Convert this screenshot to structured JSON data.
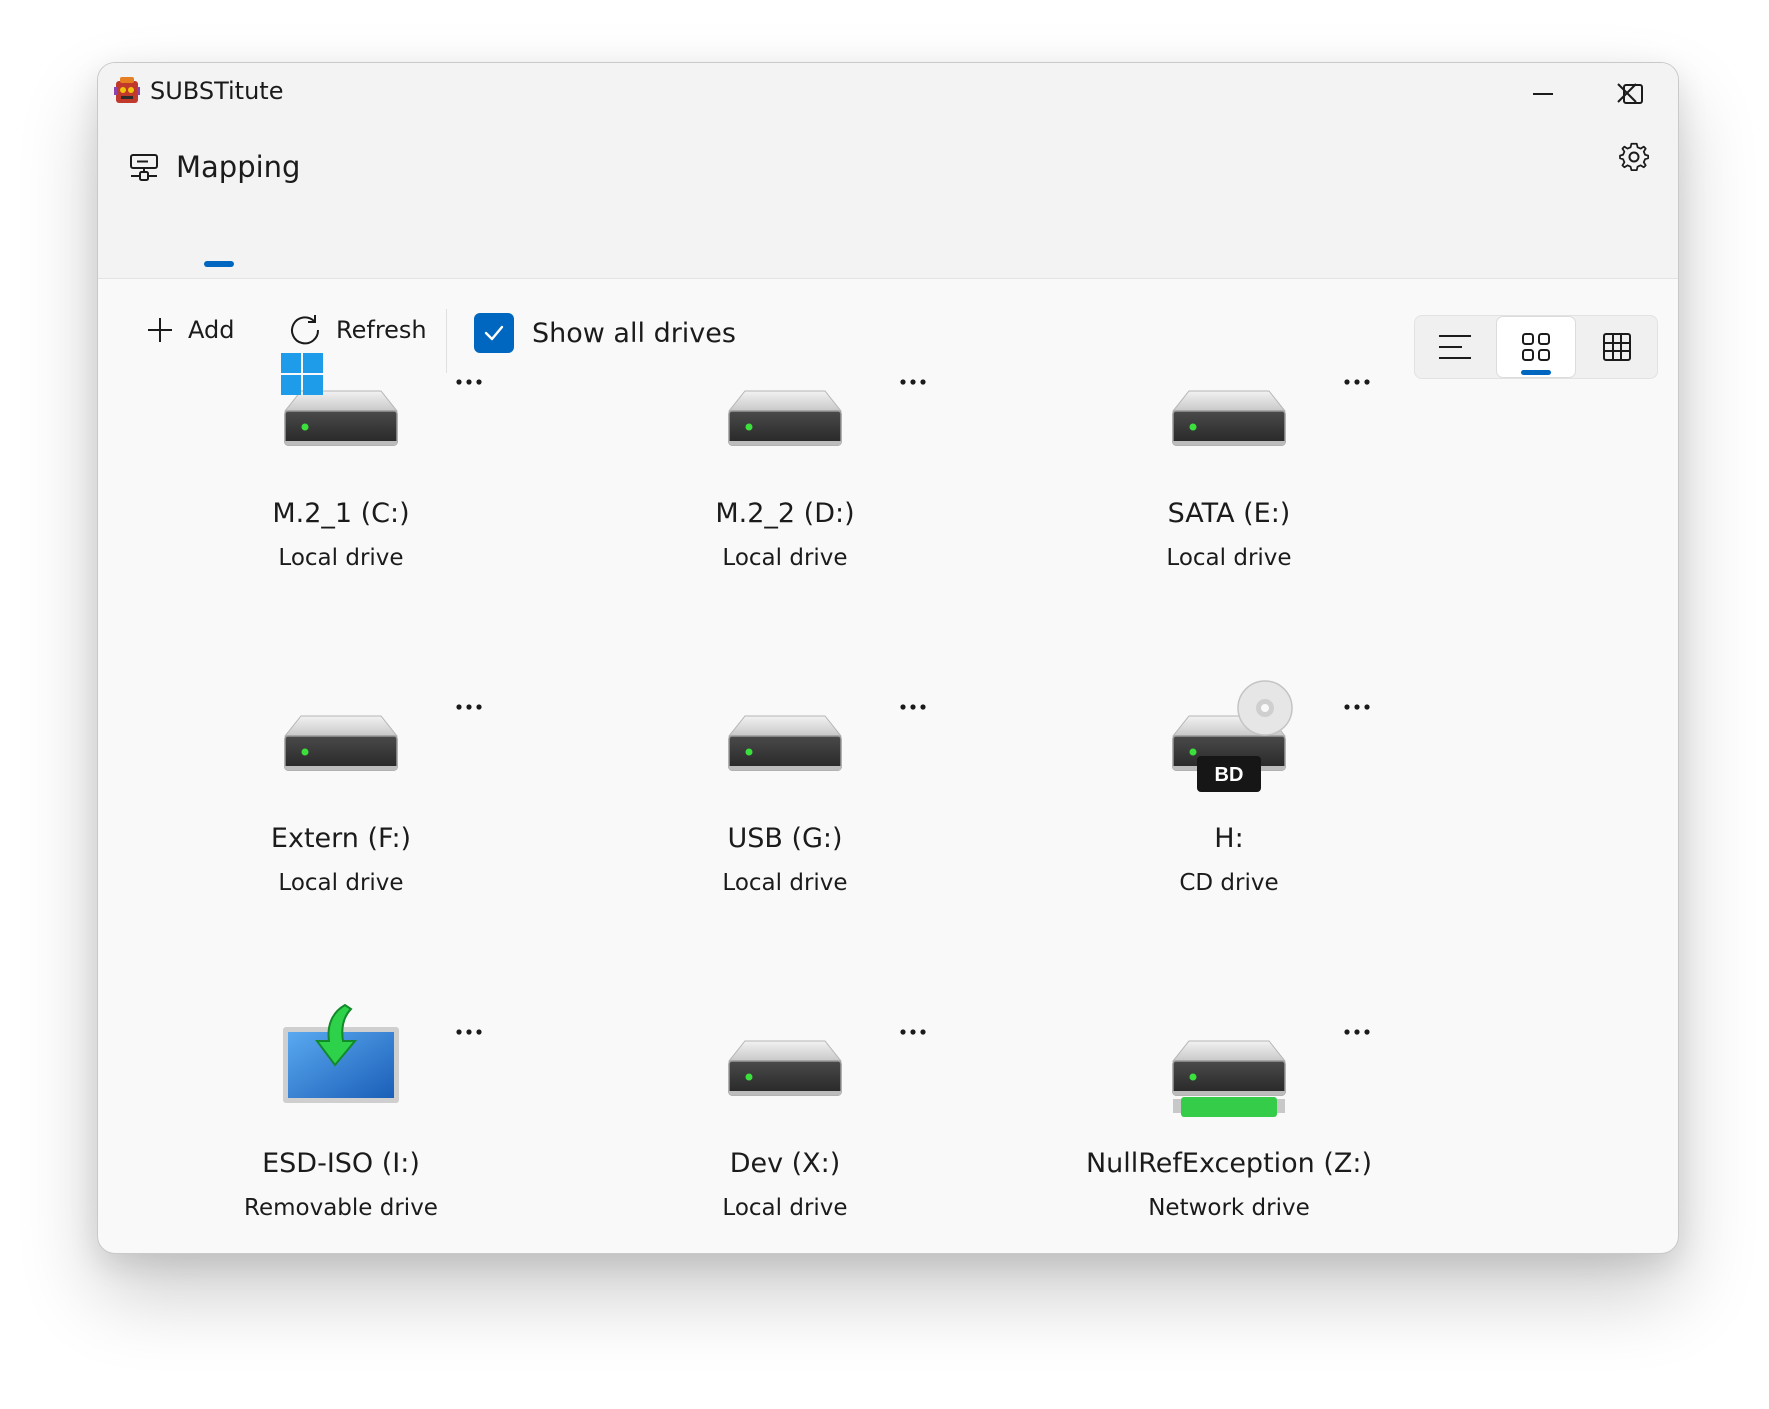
{
  "window": {
    "title": "SUBSTitute"
  },
  "nav": {
    "tab_label": "Mapping"
  },
  "toolbar": {
    "add_label": "Add",
    "refresh_label": "Refresh",
    "show_all_label": "Show all drives",
    "show_all_checked": true
  },
  "view_modes": [
    "list",
    "tiles",
    "grid"
  ],
  "active_view": "tiles",
  "colors": {
    "accent": "#0067c0"
  },
  "drives": [
    {
      "name": "M.2_1 (C:)",
      "type": "Local drive",
      "icon": "system-drive-icon"
    },
    {
      "name": "M.2_2 (D:)",
      "type": "Local drive",
      "icon": "hard-drive-icon"
    },
    {
      "name": "SATA (E:)",
      "type": "Local drive",
      "icon": "hard-drive-icon"
    },
    {
      "name": "Extern (F:)",
      "type": "Local drive",
      "icon": "hard-drive-icon"
    },
    {
      "name": "USB (G:)",
      "type": "Local drive",
      "icon": "hard-drive-icon"
    },
    {
      "name": "H:",
      "type": "CD drive",
      "icon": "bd-drive-icon",
      "badge": "BD"
    },
    {
      "name": "ESD-ISO (I:)",
      "type": "Removable drive",
      "icon": "removable-drive-icon"
    },
    {
      "name": "Dev (X:)",
      "type": "Local drive",
      "icon": "hard-drive-icon"
    },
    {
      "name": "NullRefException (Z:)",
      "type": "Network drive",
      "icon": "network-drive-icon"
    }
  ]
}
